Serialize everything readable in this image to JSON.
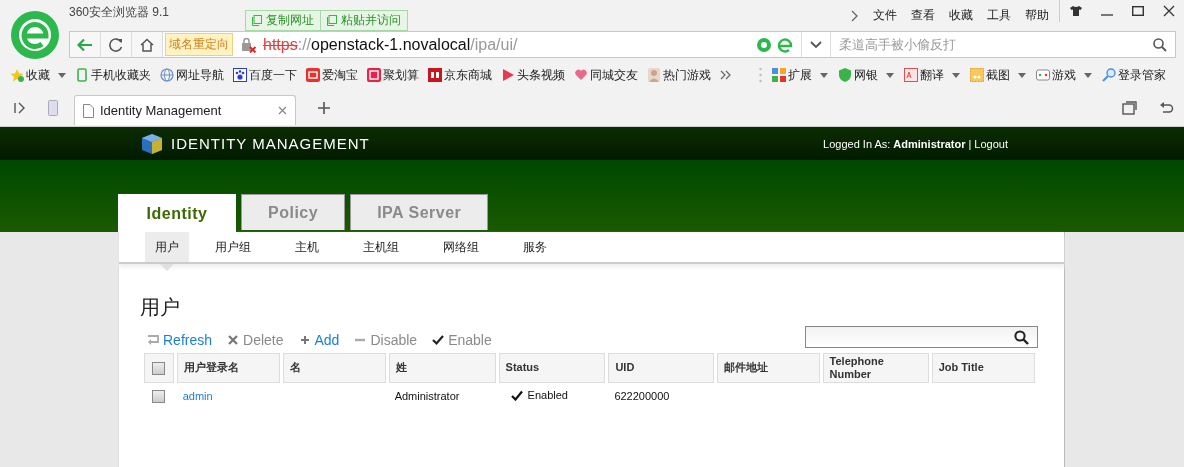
{
  "browser": {
    "title": "360安全浏览器 9.1",
    "clipboard_buttons": [
      "复制网址",
      "粘贴并访问"
    ],
    "menu": [
      "文件",
      "查看",
      "收藏",
      "工具",
      "帮助"
    ],
    "address": {
      "badge": "域名重定向",
      "scheme": "https",
      "separator": "://",
      "host": "openstack-1.novalocal",
      "path": "/ipa/ui/",
      "insecure": true
    },
    "search": {
      "placeholder": "柔道高手被小偷反打"
    },
    "bookmarks": [
      {
        "label": "收藏",
        "dropdown": true
      },
      {
        "label": "手机收藏夹",
        "dropdown": false
      },
      {
        "label": "网址导航",
        "dropdown": false
      },
      {
        "label": "百度一下",
        "dropdown": false
      },
      {
        "label": "爱淘宝",
        "dropdown": false
      },
      {
        "label": "聚划算",
        "dropdown": false
      },
      {
        "label": "京东商城",
        "dropdown": false
      },
      {
        "label": "头条视频",
        "dropdown": false
      },
      {
        "label": "同城交友",
        "dropdown": false
      },
      {
        "label": "热门游戏",
        "dropdown": false
      }
    ],
    "tools": [
      {
        "label": "扩展",
        "dropdown": true
      },
      {
        "label": "网银",
        "dropdown": true
      },
      {
        "label": "翻译",
        "dropdown": true
      },
      {
        "label": "截图",
        "dropdown": true
      },
      {
        "label": "游戏",
        "dropdown": true
      },
      {
        "label": "登录管家",
        "dropdown": false
      }
    ],
    "tabs": [
      {
        "label": "Identity Management",
        "selected": true
      }
    ]
  },
  "ipa": {
    "brand": "IDENTITY MANAGEMENT",
    "login_prefix": "Logged In As:",
    "user": "Administrator",
    "separator": "|",
    "logout": "Logout",
    "tabs": [
      {
        "label": "Identity",
        "selected": true
      },
      {
        "label": "Policy",
        "selected": false
      },
      {
        "label": "IPA Server",
        "selected": false
      }
    ],
    "subtabs": [
      {
        "label": "用户",
        "selected": true
      },
      {
        "label": "用户组",
        "selected": false
      },
      {
        "label": "主机",
        "selected": false
      },
      {
        "label": "主机组",
        "selected": false
      },
      {
        "label": "网络组",
        "selected": false
      },
      {
        "label": "服务",
        "selected": false
      }
    ],
    "title": "用户",
    "actions": [
      {
        "kind": "refresh",
        "label": "Refresh",
        "disabled": false
      },
      {
        "kind": "delete",
        "label": "Delete",
        "disabled": true
      },
      {
        "kind": "add",
        "label": "Add",
        "disabled": false
      },
      {
        "kind": "disable",
        "label": "Disable",
        "disabled": true
      },
      {
        "kind": "enable",
        "label": "Enable",
        "disabled": true
      }
    ],
    "table": {
      "select_all": false,
      "columns": [
        "用户登录名",
        "名",
        "姓",
        "Status",
        "UID",
        "邮件地址",
        "Telephone Number",
        "Job Title"
      ],
      "rows": [
        {
          "checked": false,
          "login": "admin",
          "last_name": "Administrator",
          "status": "Enabled",
          "enabled": true,
          "uid": "622200000"
        }
      ]
    }
  }
}
